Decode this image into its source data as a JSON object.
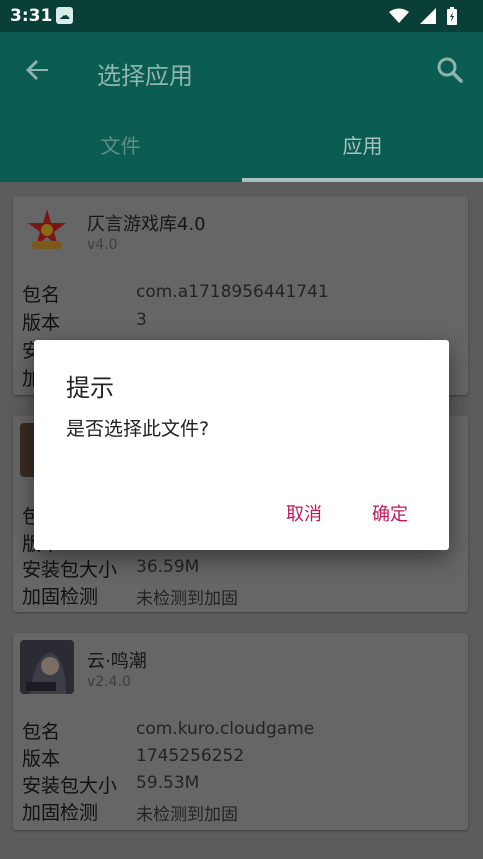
{
  "status_bar": {
    "time": "3:31",
    "notification_icon": "cloud-sync-icon",
    "icons": [
      "wifi-icon",
      "signal-icon",
      "battery-charging-icon"
    ]
  },
  "app_bar": {
    "title": "选择应用",
    "back_icon": "arrow-back-icon",
    "search_icon": "search-icon"
  },
  "tabs": [
    {
      "label": "文件",
      "active": false
    },
    {
      "label": "应用",
      "active": true
    }
  ],
  "field_labels": {
    "package": "包名",
    "version": "版本",
    "size": "安装包大小",
    "protection": "加固检测"
  },
  "apps": [
    {
      "name": "仄言游戏库4.0",
      "version": "v4.0",
      "package": "com.a1718956441741",
      "version_code": "3",
      "size": "",
      "protection": ""
    },
    {
      "name": "",
      "version": "",
      "package": "",
      "version_code": "",
      "size": "36.59M",
      "protection": "未检测到加固"
    },
    {
      "name": "云·鸣潮",
      "version": "v2.4.0",
      "package": "com.kuro.cloudgame",
      "version_code": "1745256252",
      "size": "59.53M",
      "protection": "未检测到加固"
    }
  ],
  "dialog": {
    "title": "提示",
    "message": "是否选择此文件?",
    "cancel_label": "取消",
    "confirm_label": "确定"
  },
  "colors": {
    "primary": "#0b5c52",
    "status_bar": "#0a3f38",
    "dialog_button": "#c2185b"
  }
}
